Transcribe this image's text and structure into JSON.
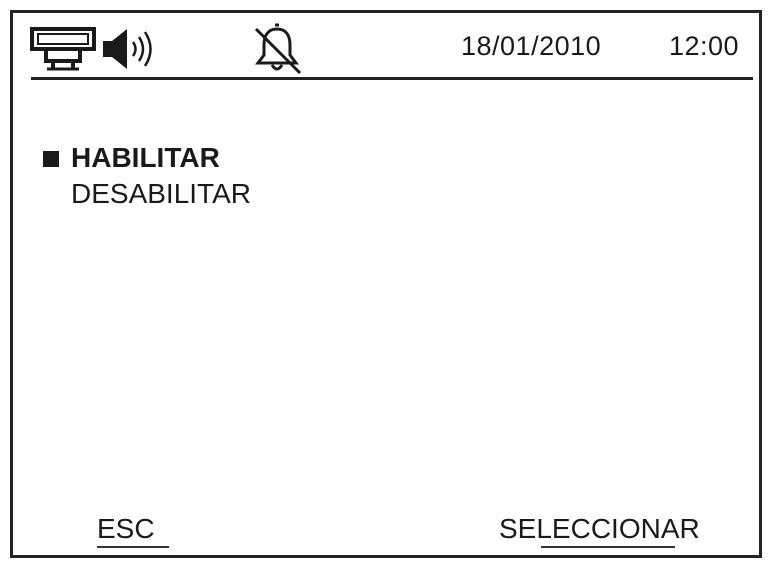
{
  "status_bar": {
    "icons": [
      "network-icon",
      "speaker-icon",
      "alarm-off-icon"
    ],
    "date": "18/01/2010",
    "time": "12:00"
  },
  "menu": {
    "items": [
      {
        "label": "HABILITAR",
        "selected": true
      },
      {
        "label": "DESABILITAR",
        "selected": false
      }
    ]
  },
  "softkeys": {
    "left_label": "ESC",
    "right_label": "SELECCIONAR"
  },
  "colors": {
    "foreground": "#1a1a1a",
    "background": "#ffffff"
  }
}
